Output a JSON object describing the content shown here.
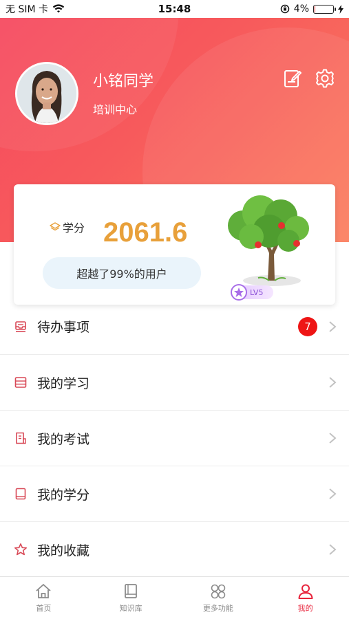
{
  "status_bar": {
    "carrier": "无 SIM 卡",
    "time": "15:48",
    "battery": "4%",
    "battery_level": 0.04
  },
  "profile": {
    "name": "小铭同学",
    "org": "培训中心"
  },
  "credits": {
    "label": "学分",
    "value": "2061.6",
    "rank_text": "超越了99%的用户",
    "level": "LV5"
  },
  "menu": {
    "items": [
      {
        "label": "待办事项",
        "icon": "inbox-icon",
        "badge": "7"
      },
      {
        "label": "我的学习",
        "icon": "list-icon"
      },
      {
        "label": "我的考试",
        "icon": "exam-icon"
      },
      {
        "label": "我的学分",
        "icon": "book-icon"
      },
      {
        "label": "我的收藏",
        "icon": "star-icon"
      }
    ]
  },
  "tabs": [
    {
      "label": "首页",
      "icon": "home-icon"
    },
    {
      "label": "知识库",
      "icon": "knowledge-icon"
    },
    {
      "label": "更多功能",
      "icon": "grid-icon"
    },
    {
      "label": "我的",
      "icon": "person-icon",
      "active": true
    }
  ],
  "colors": {
    "accent": "#e8243c",
    "header_start": "#f6485f",
    "header_end": "#fb7e5e",
    "credit_value": "#e8a03a",
    "badge": "#ee1515"
  }
}
